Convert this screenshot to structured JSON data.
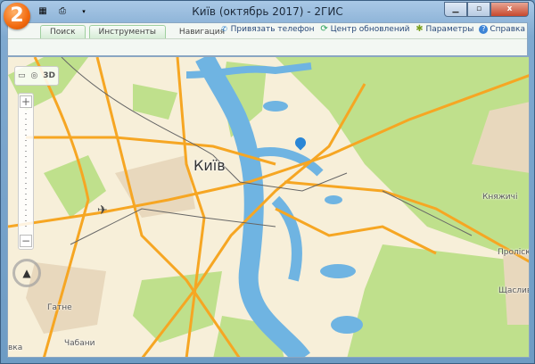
{
  "window": {
    "title": "Київ (октябрь 2017) - 2ГИС",
    "logo": "2",
    "minimize": "▁",
    "maximize": "▫",
    "close": "x"
  },
  "quick_access": [
    {
      "icon": "folder-icon"
    },
    {
      "icon": "printer-icon"
    },
    {
      "icon": "dropdown-icon"
    }
  ],
  "tabs": [
    {
      "label": "Поиск",
      "active": true
    },
    {
      "label": "Инструменты",
      "active": true
    },
    {
      "label": "Навигация",
      "active": false
    }
  ],
  "tools": [
    {
      "label": "Привязать телефон",
      "icon": "phone-icon"
    },
    {
      "label": "Центр обновлений",
      "icon": "refresh-icon"
    },
    {
      "label": "Параметры",
      "icon": "gear-icon"
    },
    {
      "label": "Справка",
      "icon": "help-icon"
    }
  ],
  "map_controls": {
    "ruler": "▭",
    "radius": "◎",
    "mode_3d": "3D",
    "zoom_in": "+",
    "zoom_out": "−",
    "compass": "▲"
  },
  "map_labels": {
    "city": "Київ",
    "k1": "Княжичі",
    "k2": "Проліск",
    "k3": "Щасливе",
    "k4": "Гатне",
    "k5": "Чабани",
    "k6": "вка"
  },
  "colors": {
    "river": "#6fb4e2",
    "road": "#f6a623",
    "forest": "#bfe08c",
    "land": "#f7efd9"
  }
}
